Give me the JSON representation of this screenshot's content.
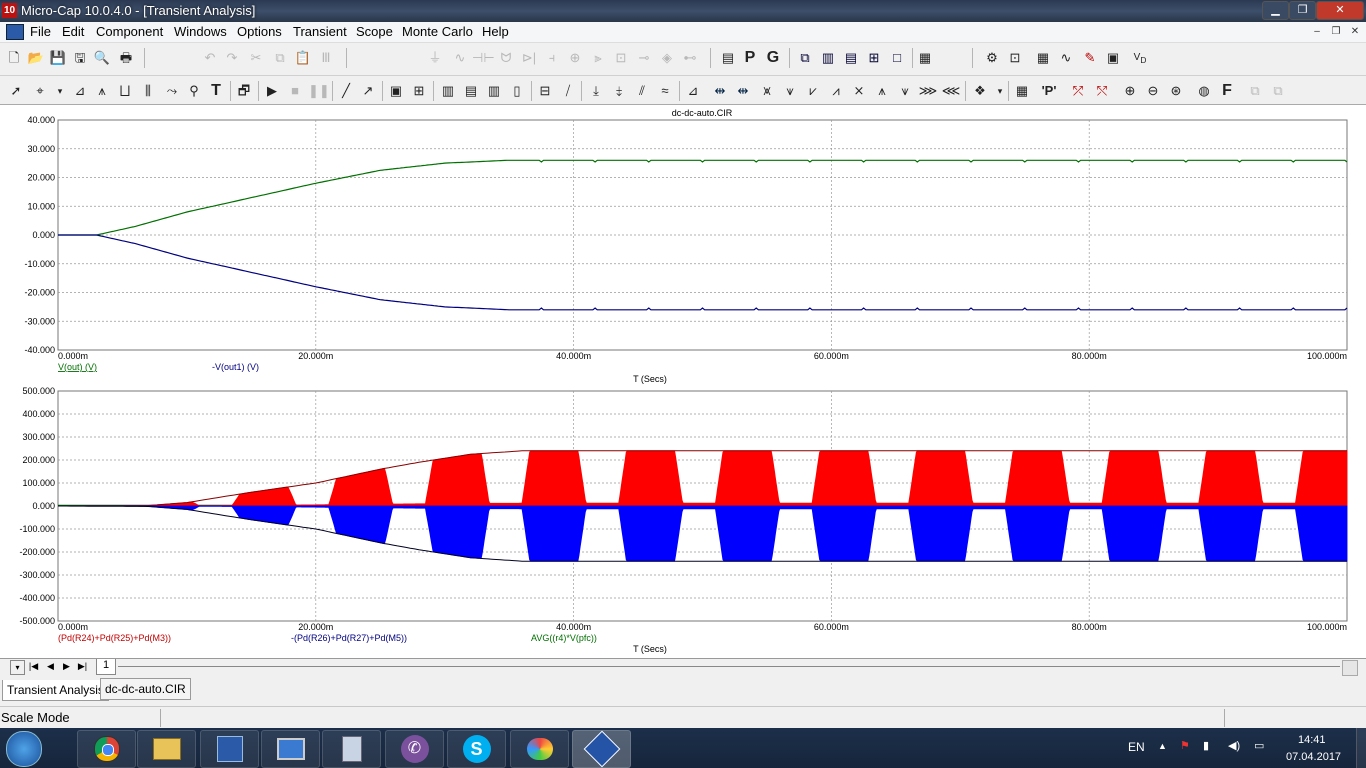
{
  "window": {
    "title": "Micro-Cap 10.0.4.0 - [Transient Analysis]",
    "app_icon": "10"
  },
  "menu": [
    "File",
    "Edit",
    "Component",
    "Windows",
    "Options",
    "Transient",
    "Scope",
    "Monte Carlo",
    "Help"
  ],
  "toolbar1_icons": [
    "new-icon",
    "open-icon",
    "save-icon",
    "save-all-icon",
    "print-preview-icon",
    "print-icon",
    "undo-icon",
    "redo-icon",
    "cut-icon",
    "copy-icon",
    "paste-icon",
    "clear-icon",
    "ground-icon",
    "resistor-icon",
    "capacitor-icon",
    "inductor-icon",
    "diode-icon",
    "battery-icon",
    "source-icon",
    "transistor-icon",
    "node-icon",
    "pin-icon",
    "select-view-icon",
    "pin-numbers-icon",
    "grid-text-icon"
  ],
  "toolbar1_glyphs": {
    "p_label": "P",
    "g_label": "G"
  },
  "toolbar2_icons": [
    "select-arrow-icon",
    "graph-mode-icon",
    "scale-icon",
    "cursor-mode-icon",
    "point-tag-icon",
    "text-icon",
    "properties-icon",
    "run-icon",
    "stop-icon",
    "pause-icon",
    "scale-mode-icon",
    "add-curve-icon"
  ],
  "plot_top": {
    "title": "dc-dc-auto.CIR",
    "y_ticks": [
      "40.000",
      "30.000",
      "20.000",
      "10.000",
      "0.000",
      "-10.000",
      "-20.000",
      "-30.000",
      "-40.000"
    ],
    "x_ticks": [
      "0.000m",
      "20.000m",
      "40.000m",
      "60.000m",
      "80.000m",
      "100.000m"
    ],
    "x_label": "T (Secs)",
    "legend": [
      {
        "text": "V(out) (V)",
        "color": "#007000"
      },
      {
        "text": "-V(out1) (V)",
        "color": "#000080"
      }
    ]
  },
  "plot_bottom": {
    "y_ticks": [
      "500.000",
      "400.000",
      "300.000",
      "200.000",
      "100.000",
      "0.000",
      "-100.000",
      "-200.000",
      "-300.000",
      "-400.000",
      "-500.000"
    ],
    "x_ticks": [
      "0.000m",
      "20.000m",
      "40.000m",
      "60.000m",
      "80.000m",
      "100.000m"
    ],
    "x_label": "T (Secs)",
    "legend": [
      {
        "text": "(Pd(R24)+Pd(R25)+Pd(M3))",
        "color": "#c00000"
      },
      {
        "text": "-(Pd(R26)+Pd(R27)+Pd(M5))",
        "color": "#000080"
      },
      {
        "text": "AVG((r4)*V(pfc))",
        "color": "#007000"
      }
    ]
  },
  "chart_data": [
    {
      "type": "line",
      "title": "dc-dc-auto.CIR",
      "xlabel": "T (Secs)",
      "ylabel": "",
      "xlim": [
        0,
        100
      ],
      "ylim": [
        -40,
        40
      ],
      "x_unit": "ms",
      "grid": true,
      "series": [
        {
          "name": "V(out) (V)",
          "color": "#007000",
          "x": [
            0,
            3,
            6,
            10,
            15,
            20,
            25,
            30,
            35,
            40,
            50,
            60,
            70,
            80,
            90,
            100
          ],
          "y": [
            0,
            0,
            3,
            8,
            13,
            18,
            22.5,
            25,
            26,
            26,
            26,
            26,
            26,
            26,
            26,
            26
          ]
        },
        {
          "name": "-V(out1) (V)",
          "color": "#000080",
          "x": [
            0,
            3,
            6,
            10,
            15,
            20,
            25,
            30,
            35,
            40,
            50,
            60,
            70,
            80,
            90,
            100
          ],
          "y": [
            0,
            0,
            -3,
            -8,
            -13,
            -18,
            -22.5,
            -25,
            -26,
            -26,
            -26,
            -26,
            -26,
            -26,
            -26,
            -26
          ]
        }
      ]
    },
    {
      "type": "line",
      "title": "",
      "xlabel": "T (Secs)",
      "ylabel": "",
      "xlim": [
        0,
        100
      ],
      "ylim": [
        -500,
        500
      ],
      "x_unit": "ms",
      "grid": true,
      "envelope": {
        "x": [
          0,
          7,
          10,
          15,
          20,
          25,
          28,
          32,
          36,
          40,
          100
        ],
        "peak": [
          0,
          2,
          15,
          60,
          100,
          160,
          190,
          225,
          240,
          240,
          240
        ]
      },
      "cycle_ms": 7.5,
      "first_cycle_start_ms": 6,
      "series": [
        {
          "name": "(Pd(R24)+Pd(R25)+Pd(M3))",
          "color": "#ff0000",
          "sign": 1
        },
        {
          "name": "-(Pd(R26)+Pd(R27)+Pd(M5))",
          "color": "#0000ff",
          "sign": -1
        },
        {
          "name": "AVG((r4)*V(pfc))",
          "color": "#007000",
          "constant": 3
        }
      ]
    }
  ],
  "page_tab": "1",
  "tabs": [
    "Transient Analysis",
    "dc-dc-auto.CIR"
  ],
  "status": {
    "mode": "Scale Mode"
  },
  "taskbar": {
    "apps": [
      "start-orb-icon",
      "chrome-icon",
      "explorer-icon",
      "calc-sheet-icon",
      "network-pc-icon",
      "calculator-icon",
      "viber-icon",
      "skype-icon",
      "paint-icon",
      "microcap-icon"
    ],
    "lang": "EN",
    "time": "14:41",
    "date": "07.04.2017"
  }
}
